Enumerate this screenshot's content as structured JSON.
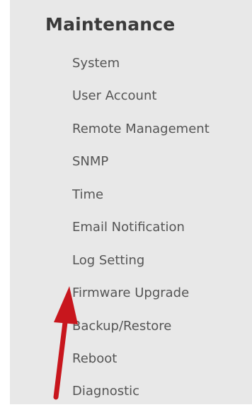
{
  "menu": {
    "title": "Maintenance",
    "items": [
      "System",
      "User Account",
      "Remote Management",
      "SNMP",
      "Time",
      "Email Notification",
      "Log Setting",
      "Firmware Upgrade",
      "Backup/Restore",
      "Reboot",
      "Diagnostic"
    ]
  },
  "annotation": {
    "arrow_color": "#c8161d",
    "points_to": "Firmware Upgrade"
  }
}
